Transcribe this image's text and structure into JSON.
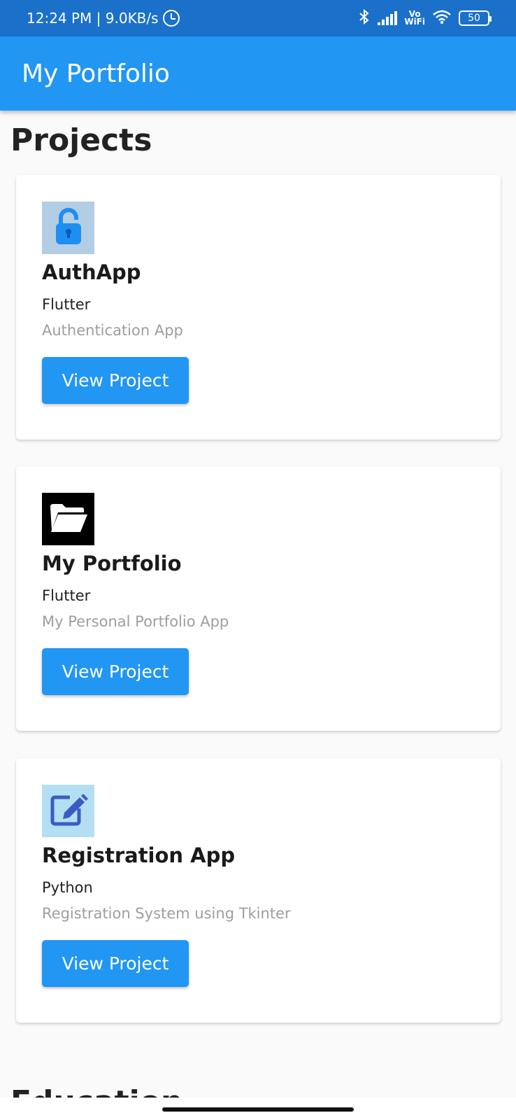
{
  "status_bar": {
    "time_speed": "12:24 PM | 9.0KB/s",
    "vowifi_top": "Vo",
    "vowifi_bottom": "WiFi",
    "battery": "50"
  },
  "app_bar": {
    "title": "My Portfolio"
  },
  "projects": {
    "heading": "Projects",
    "items": [
      {
        "name": "AuthApp",
        "tech": "Flutter",
        "description": "Authentication App",
        "button": "View Project",
        "icon": "lock-icon",
        "icon_bg": "#b3cde4",
        "icon_color": "#1e8ef2"
      },
      {
        "name": "My Portfolio",
        "tech": "Flutter",
        "description": "My Personal Portfolio App",
        "button": "View Project",
        "icon": "folder-icon",
        "icon_bg": "#000000",
        "icon_color": "#ffffff"
      },
      {
        "name": "Registration App",
        "tech": "Python",
        "description": "Registration System using Tkinter",
        "button": "View Project",
        "icon": "edit-icon",
        "icon_bg": "#b4dff3",
        "icon_color": "#3b5bc4"
      }
    ]
  },
  "education": {
    "heading": "Education"
  },
  "colors": {
    "primary": "#2196f3",
    "status_bar": "#1b71c9"
  }
}
